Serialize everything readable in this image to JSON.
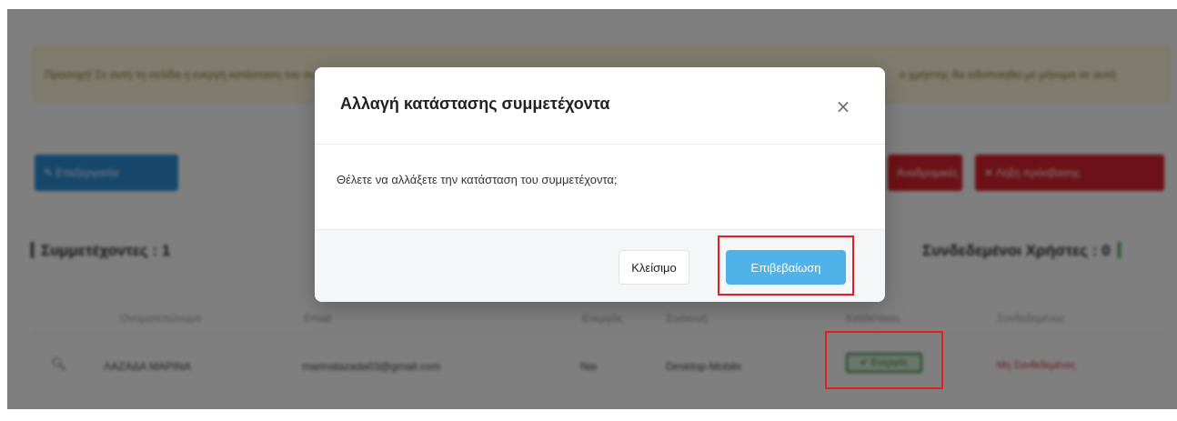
{
  "background": {
    "warning_banner": {
      "text_left": "Προσοχή! Σε αυτή τη σελίδα η ενεργή κατάσταση του συμμετέχοντα",
      "text_right": "ο χρήστης θα ειδοποιηθεί με μήνυμα σε αυτή"
    },
    "toolbar": {
      "left_button_label": "Επεξεργασία",
      "red_button_1_label": "Αναδρομικές",
      "red_button_2_label": "Λήξη πρόσβασης"
    },
    "participants_heading": "Συμμετέχοντες : 1",
    "connected_users_heading": "Συνδεδεμένοι Χρήστες : 0",
    "table": {
      "columns": [
        "Ονοματεπώνυμο",
        "Email",
        "Ενεργός",
        "Συσκευή",
        "Κατάσταση",
        "Συνδεδεμένος"
      ],
      "rows": [
        {
          "name": "ΛΑΖΑΔΑ ΜΑΡΙΝΑ",
          "email": "marinalazada03@gmail.com",
          "active": "Ναι",
          "device": "Desktop-Mobile",
          "status": "✔ Ενεργός",
          "connected": "Μη Συνδεδεμένος"
        }
      ]
    }
  },
  "modal": {
    "title": "Αλλαγή κατάστασης συμμετέχοντα",
    "close_icon": "×",
    "message": "Θέλετε να αλλάξετε την κατάσταση του συμμετέχοντα;",
    "close_button_label": "Κλείσιμο",
    "confirm_button_label": "Επιβεβαίωση"
  },
  "colors": {
    "confirm_button": "#4fb3ea",
    "highlight": "#e02020",
    "overlay": "rgba(0,0,0,0.5)"
  }
}
